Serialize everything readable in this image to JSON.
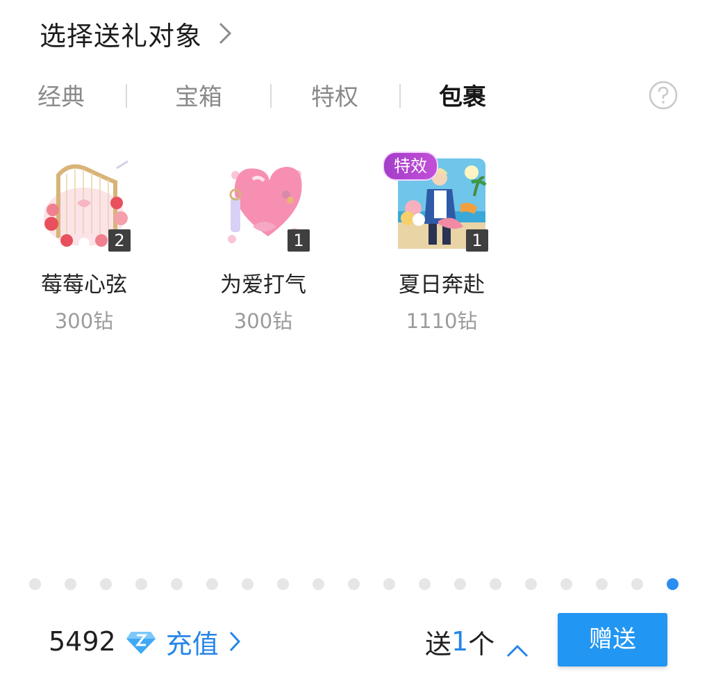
{
  "header": {
    "title": "选择送礼对象"
  },
  "tabs": [
    {
      "label": "经典",
      "active": false
    },
    {
      "label": "宝箱",
      "active": false
    },
    {
      "label": "特权",
      "active": false
    },
    {
      "label": "包裹",
      "active": true
    }
  ],
  "gifts": [
    {
      "name": "莓莓心弦",
      "price": "300钻",
      "count": "2",
      "badge": ""
    },
    {
      "name": "为爱打气",
      "price": "300钻",
      "count": "1",
      "badge": ""
    },
    {
      "name": "夏日奔赴",
      "price": "1110钻",
      "count": "1",
      "badge": "特效"
    }
  ],
  "pagination": {
    "total": 19,
    "active_index": 18
  },
  "footer": {
    "balance": "5492",
    "recharge_label": "充值",
    "send_prefix": "送",
    "send_count": "1",
    "send_suffix": "个",
    "give_label": "赠送"
  },
  "colors": {
    "accent": "#2196f3",
    "link": "#2585e8",
    "badge": "#b245d3"
  },
  "icons": [
    "chevron-right-icon",
    "help-circle-icon",
    "diamond-icon",
    "chevron-up-icon"
  ]
}
